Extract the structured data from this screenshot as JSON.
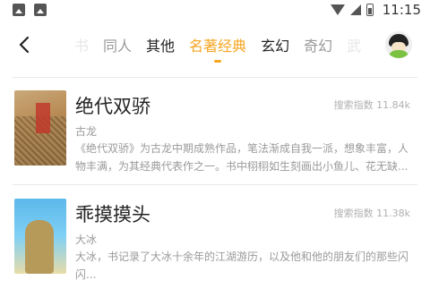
{
  "status_bar": {
    "time": "11:15",
    "left_icons": [
      "image-icon",
      "photo-icon"
    ],
    "right_icons": [
      "wifi-icon",
      "signal-icon",
      "battery-icon"
    ]
  },
  "nav": {
    "back_icon": "back-arrow-icon",
    "tabs": [
      {
        "label": "书",
        "state": "faded"
      },
      {
        "label": "同人",
        "state": "normal"
      },
      {
        "label": "其他",
        "state": "normal"
      },
      {
        "label": "名著经典",
        "state": "active"
      },
      {
        "label": "玄幻",
        "state": "normal"
      },
      {
        "label": "奇幻",
        "state": "normal"
      },
      {
        "label": "武",
        "state": "faded"
      }
    ],
    "accent_color": "#f5a623"
  },
  "books": [
    {
      "title": "绝代双骄",
      "author": "古龙",
      "search_index": "搜索指数 11.84k",
      "description": "《绝代双骄》为古龙中期成熟作品，笔法渐成自我一派，想象丰富，人物丰满，为其经典代表作之一。书中栩栩如生刻画出小鱼儿、花无缺..."
    },
    {
      "title": "乖摸摸头",
      "author": "大冰",
      "search_index": "搜索指数 11.38k",
      "description": "大冰，书记录了大冰十余年的江湖游历，以及他和他的朋友们的那些闪闪..."
    }
  ]
}
